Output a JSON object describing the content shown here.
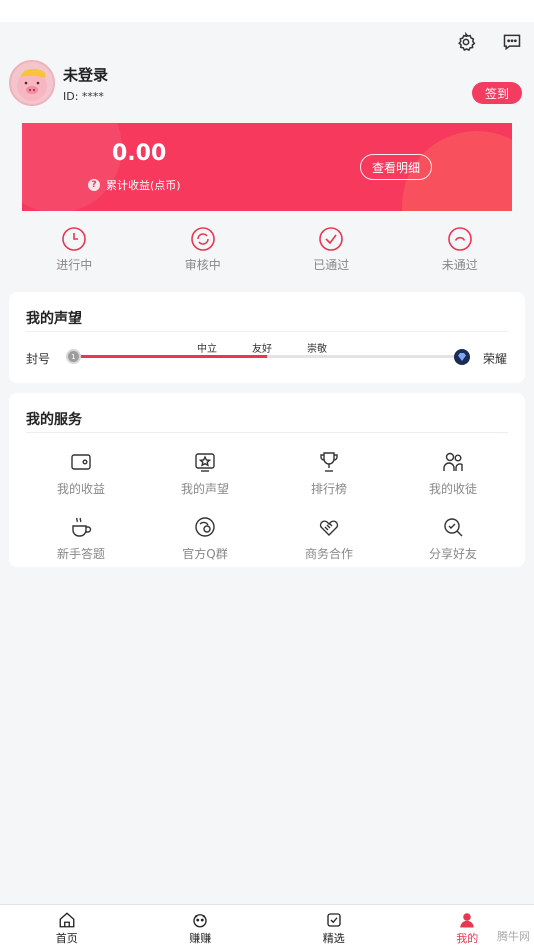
{
  "header": {
    "settings_icon": "gear-icon",
    "message_icon": "chat-bubble-icon"
  },
  "profile": {
    "name": "未登录",
    "id_text": "ID: ****",
    "sign_in_label": "签到"
  },
  "earnings": {
    "amount": "0.00",
    "label": "累计收益(点币)",
    "detail_button": "查看明细",
    "color": "#f6395c"
  },
  "status_tabs": [
    {
      "label": "进行中",
      "icon": "clock-icon"
    },
    {
      "label": "审核中",
      "icon": "refresh-search-icon"
    },
    {
      "label": "已通过",
      "icon": "check-circle-icon"
    },
    {
      "label": "未通过",
      "icon": "frown-circle-icon"
    }
  ],
  "reputation": {
    "title": "我的声望",
    "left_label": "封号",
    "right_label": "荣耀",
    "levels": [
      "中立",
      "友好",
      "崇敬"
    ],
    "progress": 0.5,
    "accent": "#e8374f"
  },
  "services": {
    "title": "我的服务",
    "items": [
      {
        "label": "我的收益",
        "icon": "wallet-icon"
      },
      {
        "label": "我的声望",
        "icon": "star-badge-icon"
      },
      {
        "label": "排行榜",
        "icon": "trophy-icon"
      },
      {
        "label": "我的收徒",
        "icon": "users-icon"
      },
      {
        "label": "新手答题",
        "icon": "coffee-cup-icon"
      },
      {
        "label": "官方Q群",
        "icon": "group-chat-icon"
      },
      {
        "label": "商务合作",
        "icon": "handshake-icon"
      },
      {
        "label": "分享好友",
        "icon": "share-search-icon"
      }
    ]
  },
  "bottom_nav": [
    {
      "label": "首页",
      "icon": "home-icon"
    },
    {
      "label": "赚赚",
      "icon": "piggy-icon"
    },
    {
      "label": "精选",
      "icon": "selection-icon"
    },
    {
      "label": "我的",
      "icon": "profile-icon",
      "active": true
    }
  ],
  "watermark": "腾牛网"
}
